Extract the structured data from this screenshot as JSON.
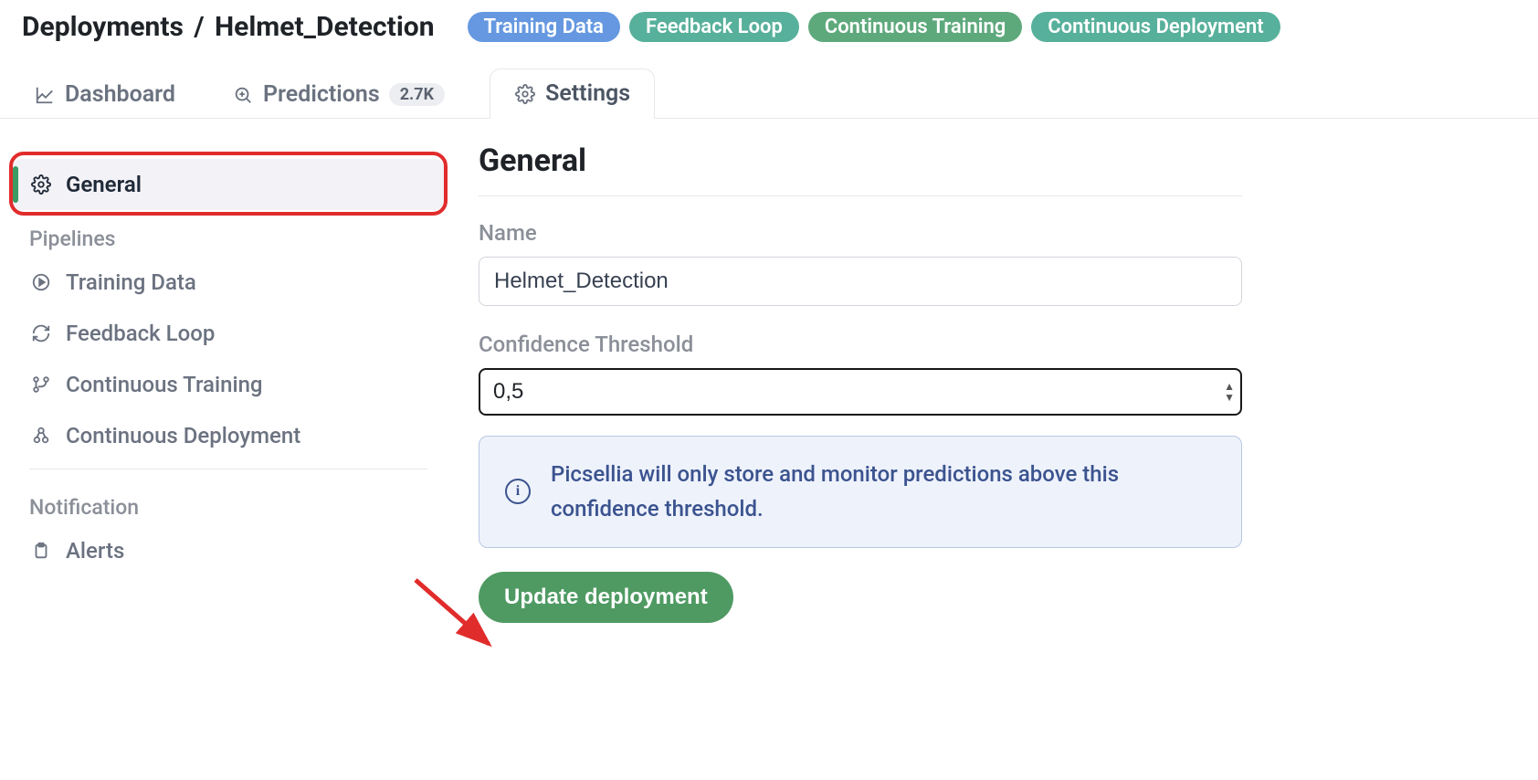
{
  "breadcrumb": {
    "root": "Deployments",
    "current": "Helmet_Detection"
  },
  "header_badges": [
    {
      "label": "Training Data",
      "class": "badge-blue"
    },
    {
      "label": "Feedback Loop",
      "class": "badge-teal"
    },
    {
      "label": "Continuous Training",
      "class": "badge-green"
    },
    {
      "label": "Continuous Deployment",
      "class": "badge-teal"
    }
  ],
  "tabs": {
    "dashboard": "Dashboard",
    "predictions": "Predictions",
    "predictions_count": "2.7K",
    "settings": "Settings"
  },
  "sidebar": {
    "general": "General",
    "pipelines_header": "Pipelines",
    "training_data": "Training Data",
    "feedback_loop": "Feedback Loop",
    "continuous_training": "Continuous Training",
    "continuous_deployment": "Continuous Deployment",
    "notification_header": "Notification",
    "alerts": "Alerts"
  },
  "panel": {
    "title": "General",
    "name_label": "Name",
    "name_value": "Helmet_Detection",
    "threshold_label": "Confidence Threshold",
    "threshold_value": "0,5",
    "info_text": "Picsellia will only store and monitor predictions above this confidence threshold.",
    "update_button": "Update deployment"
  }
}
